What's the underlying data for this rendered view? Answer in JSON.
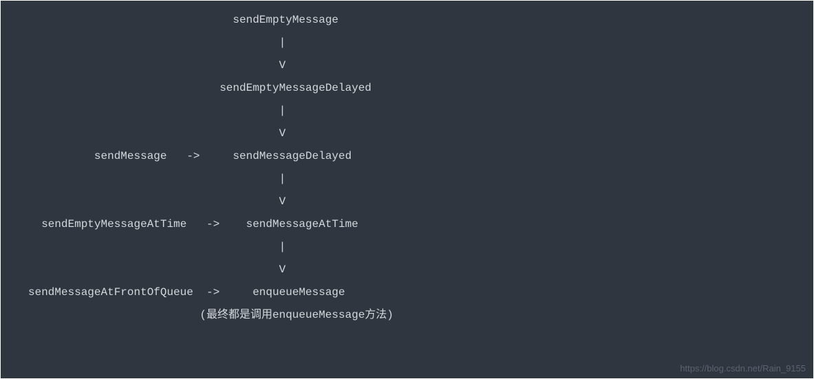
{
  "code": {
    "lines": [
      "                               sendEmptyMessage",
      "                                      |",
      "                                      V",
      "                             sendEmptyMessageDelayed",
      "                                      |",
      "                                      V",
      "          sendMessage   ->     sendMessageDelayed",
      "                                      |",
      "                                      V",
      "  sendEmptyMessageAtTime   ->    sendMessageAtTime",
      "                                      |",
      "                                      V",
      "sendMessageAtFrontOfQueue  ->     enqueueMessage",
      "                          (最终都是调用enqueueMessage方法)"
    ]
  },
  "watermark": {
    "text": "https://blog.csdn.net/Rain_9155"
  }
}
